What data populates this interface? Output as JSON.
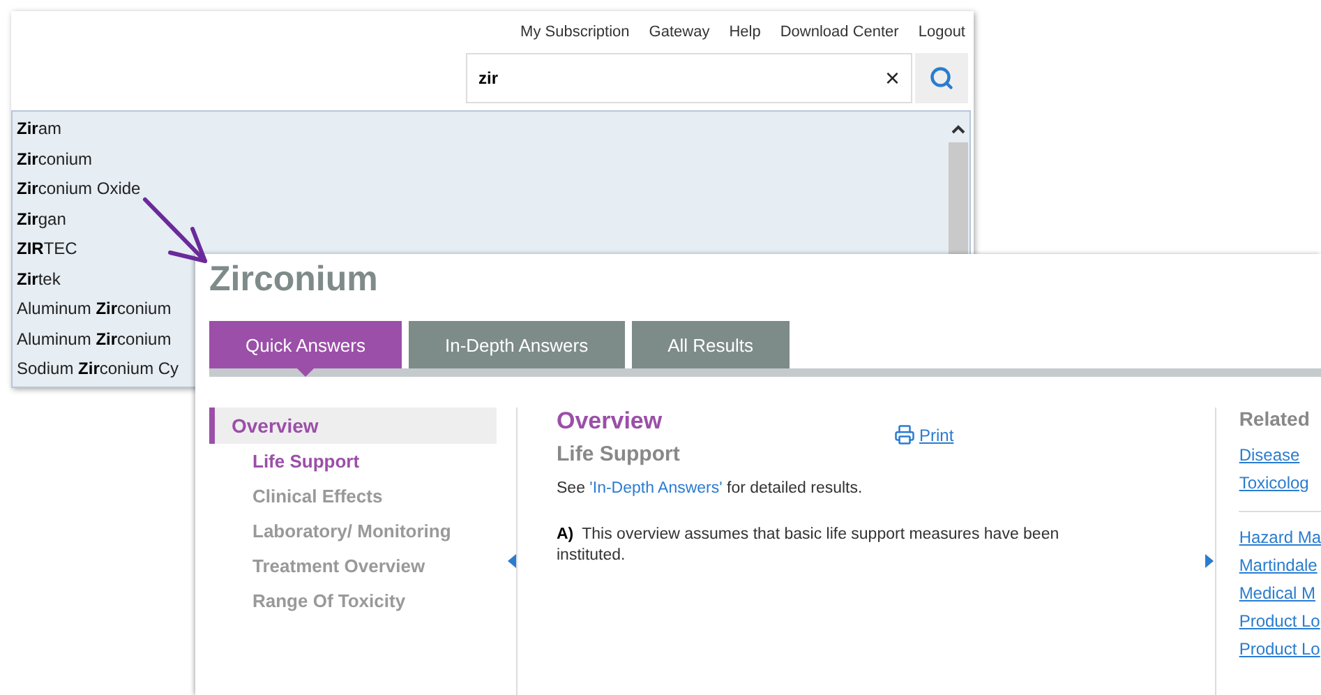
{
  "back_window": {
    "top_links": [
      "My Subscription",
      "Gateway",
      "Help",
      "Download Center",
      "Logout"
    ],
    "search": {
      "value": "zir",
      "clear": "×"
    },
    "suggestions": [
      "**Zir**am",
      "**Zir**conium",
      "**Zir**conium Oxide",
      "**Zir**gan",
      "**ZIR**TEC",
      "**Zir**tek",
      "Aluminum **Zir**conium",
      "Aluminum **Zir**conium",
      "Sodium **Zir**conium Cy"
    ]
  },
  "front_window": {
    "title": "Zirconium",
    "tabs": [
      {
        "label": "Quick Answers",
        "selected": true
      },
      {
        "label": "In-Depth Answers",
        "selected": false
      },
      {
        "label": "All Results",
        "selected": false
      }
    ],
    "nav": [
      {
        "label": "Overview",
        "selected": true,
        "children": [
          {
            "label": "Life Support",
            "selected": true
          },
          {
            "label": "Clinical Effects",
            "selected": false
          },
          {
            "label": "Laboratory/ Monitoring",
            "selected": false
          },
          {
            "label": "Treatment Overview",
            "selected": false
          },
          {
            "label": "Range Of Toxicity",
            "selected": false
          }
        ]
      }
    ],
    "content": {
      "heading": "Overview",
      "print": "Print",
      "subheading": "Life Support",
      "note_before": "See ",
      "note_link": "'In-Depth Answers'",
      "note_after": " for detailed results.",
      "points": [
        {
          "label": "A)",
          "text": "This overview assumes that basic life support measures have been instituted."
        }
      ]
    },
    "related": {
      "title": "Related",
      "groups": [
        [
          "Disease",
          "Toxicolog"
        ],
        [
          "Hazard Ma",
          "Martindale",
          "Medical M",
          "Product Lo",
          "Product Lo"
        ]
      ]
    }
  }
}
